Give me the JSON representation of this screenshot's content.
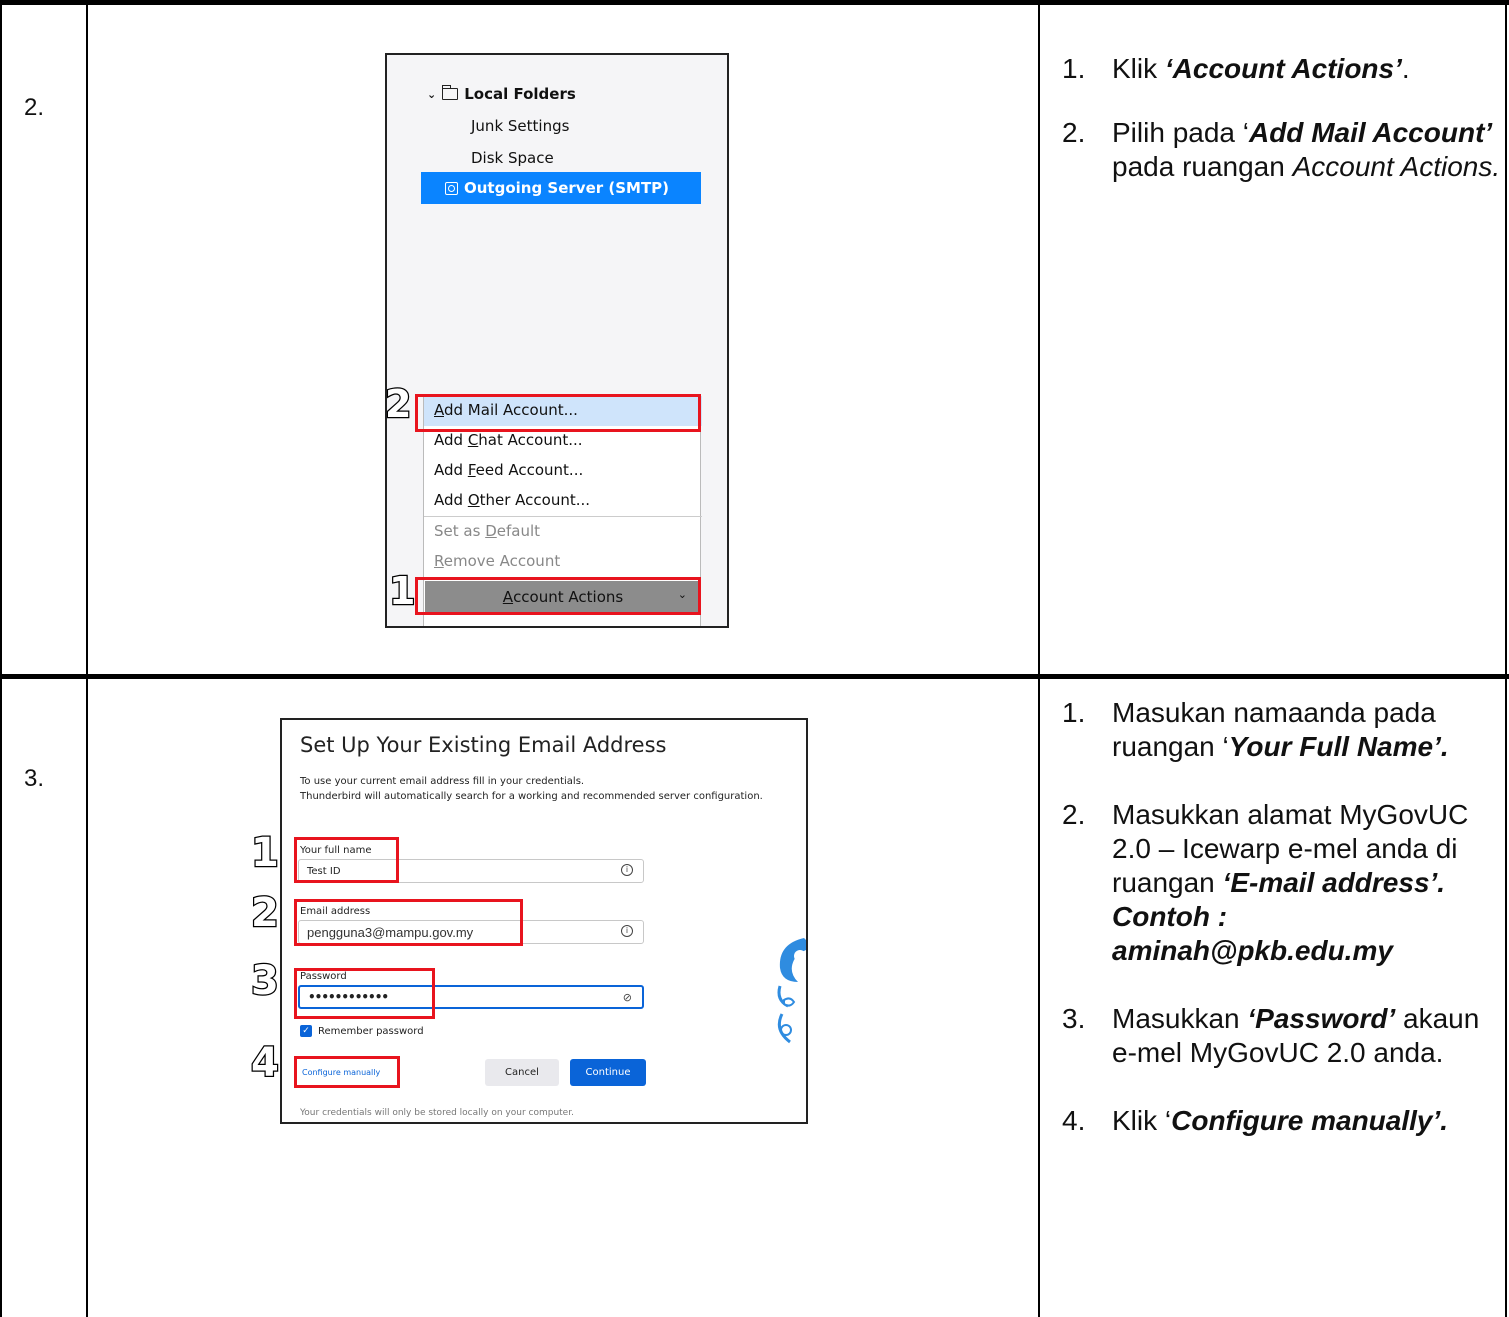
{
  "rows": [
    {
      "number": "2.",
      "steps": [
        {
          "n": "1.",
          "parts": [
            {
              "t": "Klik "
            },
            {
              "t": "‘Account Actions’",
              "s": "bi"
            },
            {
              "t": "."
            }
          ]
        },
        {
          "n": "2.",
          "parts": [
            {
              "t": "Pilih pada ‘"
            },
            {
              "t": "Add Mail Account’",
              "s": "bi"
            },
            {
              "t": " pada ruangan "
            },
            {
              "t": "Account Actions.",
              "s": "i"
            }
          ]
        }
      ]
    },
    {
      "number": "3.",
      "steps": [
        {
          "n": "1.",
          "parts": [
            {
              "t": "Masukan namaanda pada ruangan ‘"
            },
            {
              "t": "Your Full Name’.",
              "s": "bi"
            }
          ]
        },
        {
          "n": "2.",
          "parts": [
            {
              "t": "Masukkan alamat MyGovUC 2.0 – Icewarp e-mel anda di ruangan "
            },
            {
              "t": "‘E-mail address’. Contoh : aminah@pkb.edu.my",
              "s": "bi"
            }
          ]
        },
        {
          "n": "3.",
          "parts": [
            {
              "t": "Masukkan "
            },
            {
              "t": "‘Password’",
              "s": "bi"
            },
            {
              "t": " akaun e-mel MyGovUC 2.0 anda."
            }
          ]
        },
        {
          "n": "4.",
          "parts": [
            {
              "t": "Klik ‘"
            },
            {
              "t": "Configure manually’.",
              "s": "bi"
            }
          ]
        }
      ]
    }
  ],
  "account_panel": {
    "tree_root": "Local Folders",
    "tree_items": [
      "Junk Settings",
      "Disk Space"
    ],
    "selected_item": "Outgoing Server (SMTP)",
    "menu_items": [
      {
        "pre": "",
        "key": "A",
        "post": "dd Mail Account...",
        "disabled": false
      },
      {
        "pre": "Add ",
        "key": "C",
        "post": "hat Account...",
        "disabled": false
      },
      {
        "pre": "Add ",
        "key": "F",
        "post": "eed Account...",
        "disabled": false
      },
      {
        "pre": "Add ",
        "key": "O",
        "post": "ther Account...",
        "disabled": false
      },
      {
        "pre": "Set as ",
        "key": "D",
        "post": "efault",
        "disabled": true
      },
      {
        "pre": "",
        "key": "R",
        "post": "emove Account",
        "disabled": true
      }
    ],
    "account_actions": {
      "pre": "",
      "key": "A",
      "post": "ccount Actions"
    },
    "badges": [
      "2",
      "1"
    ]
  },
  "setup_dialog": {
    "title": "Set Up Your Existing Email Address",
    "subtitle_1": "To use your current email address fill in your credentials.",
    "subtitle_2": "Thunderbird will automatically search for a working and recommended server configuration.",
    "full_name_label": "Your full name",
    "full_name_value": "Test ID",
    "email_label": "Email address",
    "email_value": "pengguna3@mampu.gov.my",
    "password_label": "Password",
    "password_value": "••••••••••••",
    "remember_label": "Remember password",
    "configure_manually": "Configure manually",
    "cancel": "Cancel",
    "continue": "Continue",
    "footer": "Your credentials will only be stored locally on your computer.",
    "badges": [
      "1",
      "2",
      "3",
      "4"
    ]
  },
  "colors": {
    "highlight_red": "#e8141e",
    "selection_blue": "#0a84ff",
    "primary_blue": "#0a64d8"
  }
}
